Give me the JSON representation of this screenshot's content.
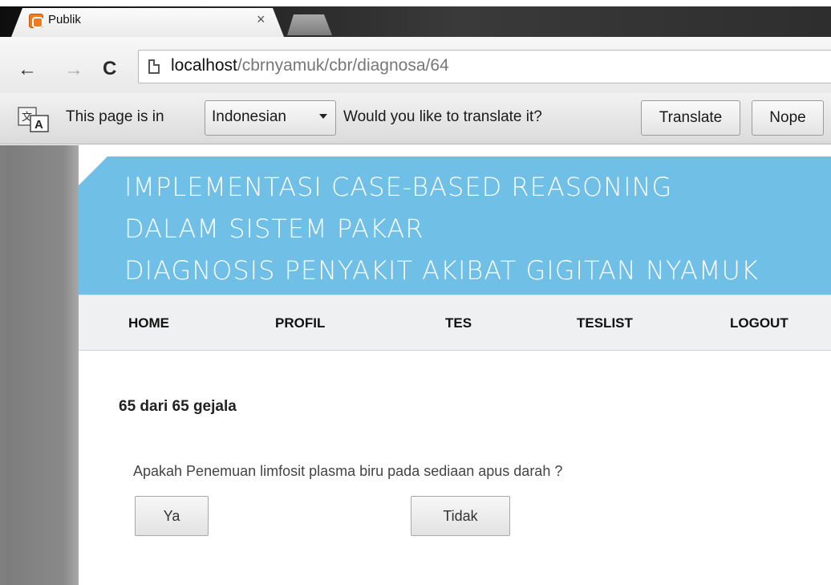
{
  "browser": {
    "tab": {
      "title": "Publik",
      "close_glyph": "×"
    },
    "nav": {
      "back_glyph": "←",
      "forward_glyph": "→",
      "reload_glyph": "C"
    },
    "url": {
      "host": "localhost",
      "path": "/cbrnyamuk/cbr/diagnosa/64"
    }
  },
  "translate_bar": {
    "text_before": "This page is in",
    "language": "Indonesian",
    "text_after": "Would you like to translate it?",
    "translate_label": "Translate",
    "nope_label": "Nope"
  },
  "header": {
    "line1": "IMPLEMENTASI CASE-BASED REASONING",
    "line2": "DALAM SISTEM PAKAR",
    "line3": "DIAGNOSIS PENYAKIT AKIBAT GIGITAN NYAMUK",
    "banner_color": "#6fbfe6"
  },
  "menu": {
    "items": [
      {
        "label": "HOME"
      },
      {
        "label": "PROFIL"
      },
      {
        "label": "TES"
      },
      {
        "label": "TESLIST"
      },
      {
        "label": "LOGOUT"
      }
    ]
  },
  "main": {
    "counter": "65 dari 65 gejala",
    "question": "Apakah Penemuan limfosit plasma biru pada sediaan apus darah ?",
    "yes_label": "Ya",
    "no_label": "Tidak"
  }
}
